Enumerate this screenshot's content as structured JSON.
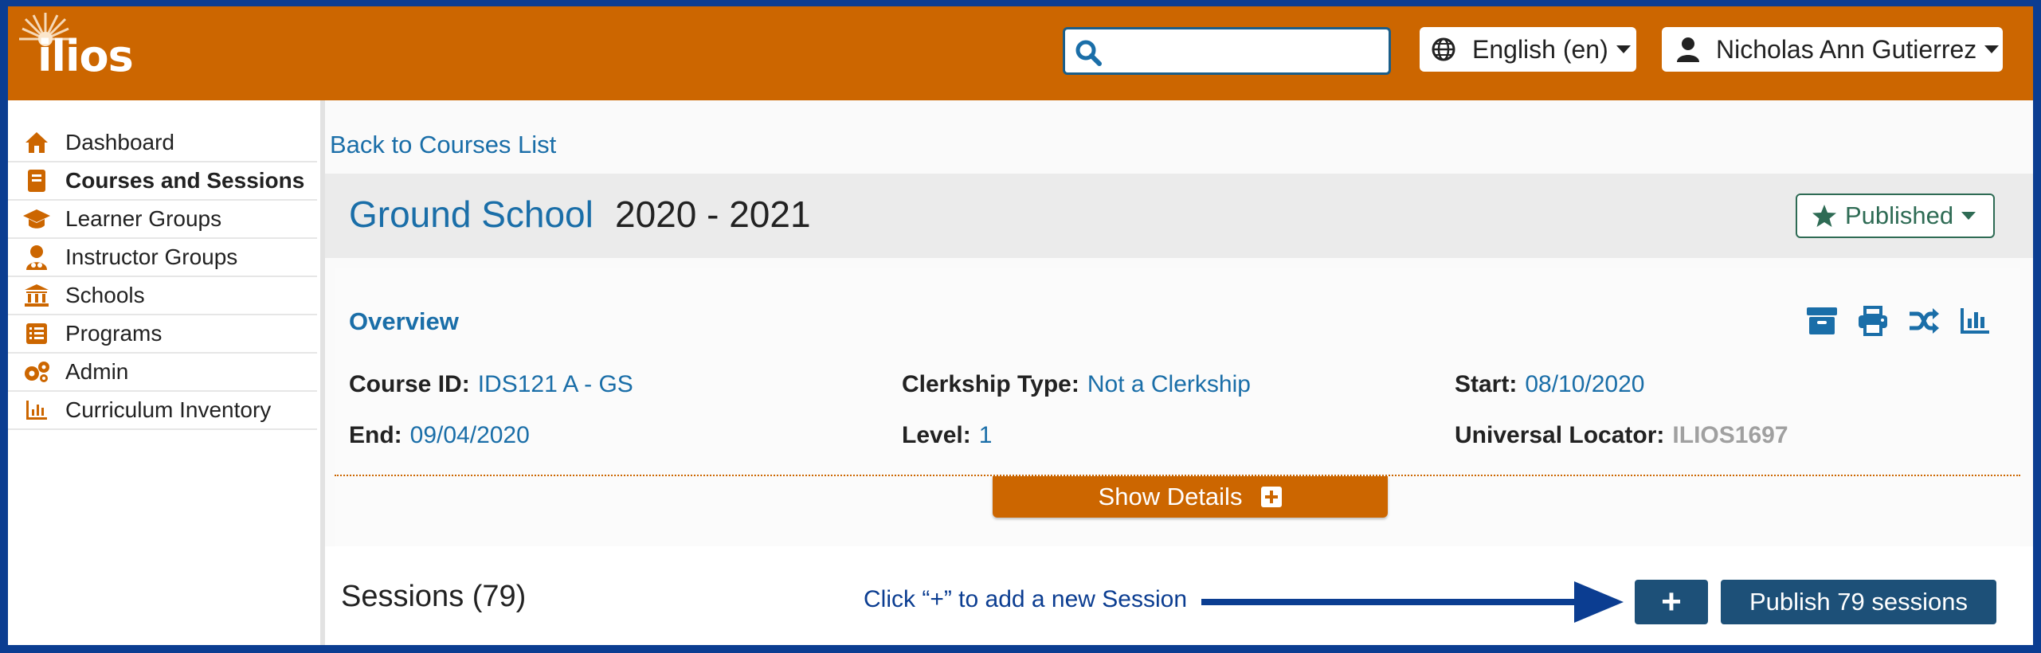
{
  "header": {
    "logo_text": "ilios",
    "search": {
      "placeholder": "",
      "value": ""
    },
    "language_label": "English (en)",
    "user_label": "Nicholas Ann Gutierrez",
    "brand_color": "#cc6600"
  },
  "sidebar": {
    "items": [
      {
        "label": "Dashboard",
        "icon": "home-icon",
        "active": false
      },
      {
        "label": "Courses and Sessions",
        "icon": "book-icon",
        "active": true
      },
      {
        "label": "Learner Groups",
        "icon": "graduation-cap-icon",
        "active": false
      },
      {
        "label": "Instructor Groups",
        "icon": "user-doctor-icon",
        "active": false
      },
      {
        "label": "Schools",
        "icon": "university-icon",
        "active": false
      },
      {
        "label": "Programs",
        "icon": "list-icon",
        "active": false
      },
      {
        "label": "Admin",
        "icon": "gears-icon",
        "active": false
      },
      {
        "label": "Curriculum Inventory",
        "icon": "chart-icon",
        "active": false
      }
    ]
  },
  "main": {
    "back_link": "Back to Courses List",
    "course_title": "Ground School",
    "course_year": "2020 - 2021",
    "publish_status": "Published",
    "overview": {
      "title": "Overview",
      "icons": [
        "archive-icon",
        "print-icon",
        "random-icon",
        "chart-bar-icon"
      ],
      "course_id_label": "Course ID:",
      "course_id": "IDS121 A - GS",
      "clerkship_label": "Clerkship Type:",
      "clerkship": "Not a Clerkship",
      "start_label": "Start:",
      "start": "08/10/2020",
      "end_label": "End:",
      "end": "09/04/2020",
      "level_label": "Level:",
      "level": "1",
      "locator_label": "Universal Locator:",
      "locator": "ILIOS1697",
      "show_details": "Show Details"
    },
    "sessions": {
      "title": "Sessions (79)",
      "hint": "Click “+” to add a new Session",
      "add_label": "+",
      "publish_label": "Publish 79 sessions"
    }
  }
}
